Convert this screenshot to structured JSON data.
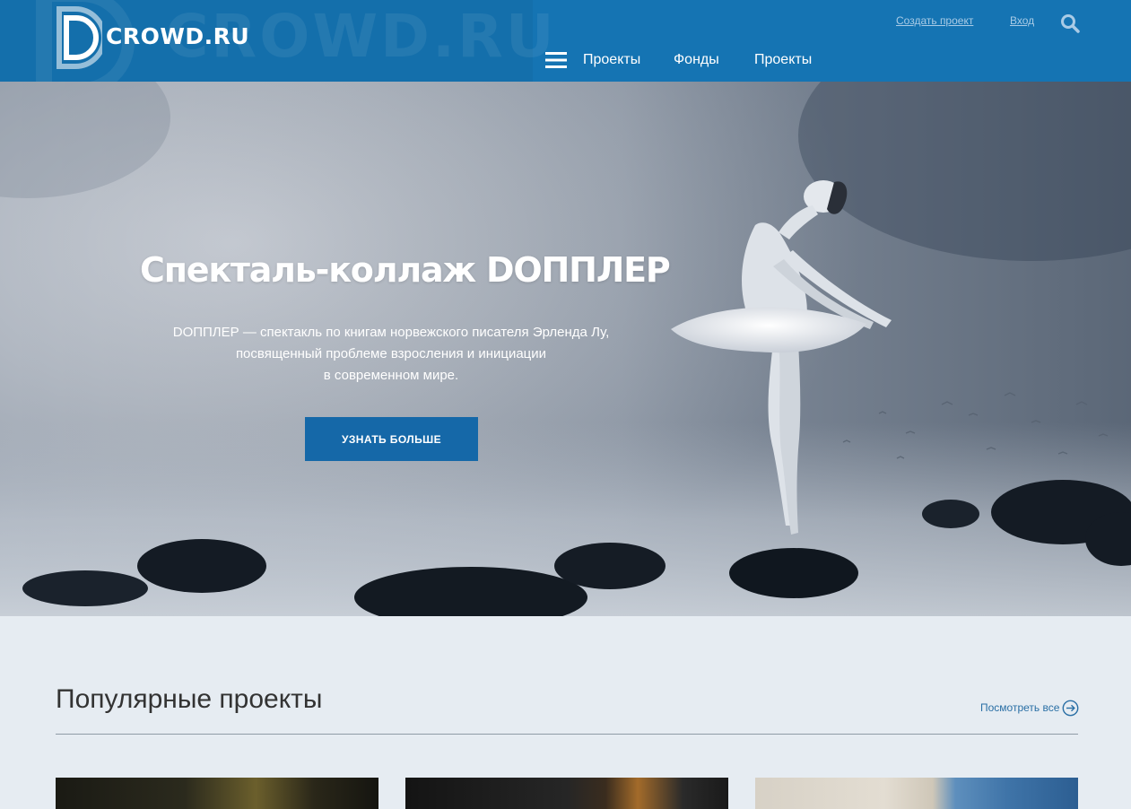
{
  "header": {
    "logo_text": "CROWD.RU",
    "watermark_text": "CROWD.RU",
    "create_project": "Создать проект",
    "login": "Вход",
    "nav": [
      "Проекты",
      "Фонды",
      "Проекты"
    ]
  },
  "hero": {
    "title": "Спекталь-коллаж DОППЛЕР",
    "description": [
      "DОППЛЕР — спектакль по книгам норвежского писателя Эрленда Лу,",
      "посвященный проблеме взросления и инициации",
      "в современном мире."
    ],
    "button": "УЗНАТЬ БОЛЬШЕ"
  },
  "popular": {
    "title": "Популярные проекты",
    "view_all": "Посмотреть все"
  },
  "icons": {
    "search": "search-icon",
    "menu": "hamburger-menu-icon",
    "view_all": "arrow-right-circle-icon"
  },
  "colors": {
    "header_bg": "#1574b3",
    "button_bg": "#1568a8",
    "page_bg": "#e6ecf2",
    "link": "#2a6fa5"
  }
}
